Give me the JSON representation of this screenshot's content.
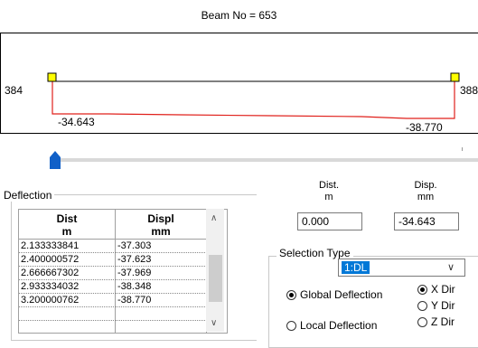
{
  "title": "Beam No = 653",
  "beam": {
    "start_node": "384",
    "end_node": "388",
    "start_deflection": "-34.643",
    "end_deflection": "-38.770"
  },
  "deflection": {
    "group_label": "Deflection",
    "columns": [
      {
        "label": "Dist",
        "unit": "m"
      },
      {
        "label": "Displ",
        "unit": "mm"
      }
    ],
    "rows": [
      [
        "2.133333841",
        "-37.303"
      ],
      [
        "2.400000572",
        "-37.623"
      ],
      [
        "2.666667302",
        "-37.969"
      ],
      [
        "2.933334032",
        "-38.348"
      ],
      [
        "3.200000762",
        "-38.770"
      ]
    ]
  },
  "inputs": {
    "dist_label": "Dist.",
    "dist_unit": "m",
    "dist_value": "0.000",
    "disp_label": "Disp.",
    "disp_unit": "mm",
    "disp_value": "-34.643"
  },
  "selection": {
    "group_label": "Selection Type",
    "load_case": "1:DL",
    "global_label": "Global Deflection",
    "local_label": "Local Deflection",
    "x_dir": "X Dir",
    "y_dir": "Y Dir",
    "z_dir": "Z Dir",
    "selected_mode": "global",
    "selected_dir": "x"
  },
  "colors": {
    "deflection_line": "#e0201b",
    "node_marker": "#ffff00",
    "slider_thumb": "#1060c8",
    "highlight": "#0078d7"
  }
}
